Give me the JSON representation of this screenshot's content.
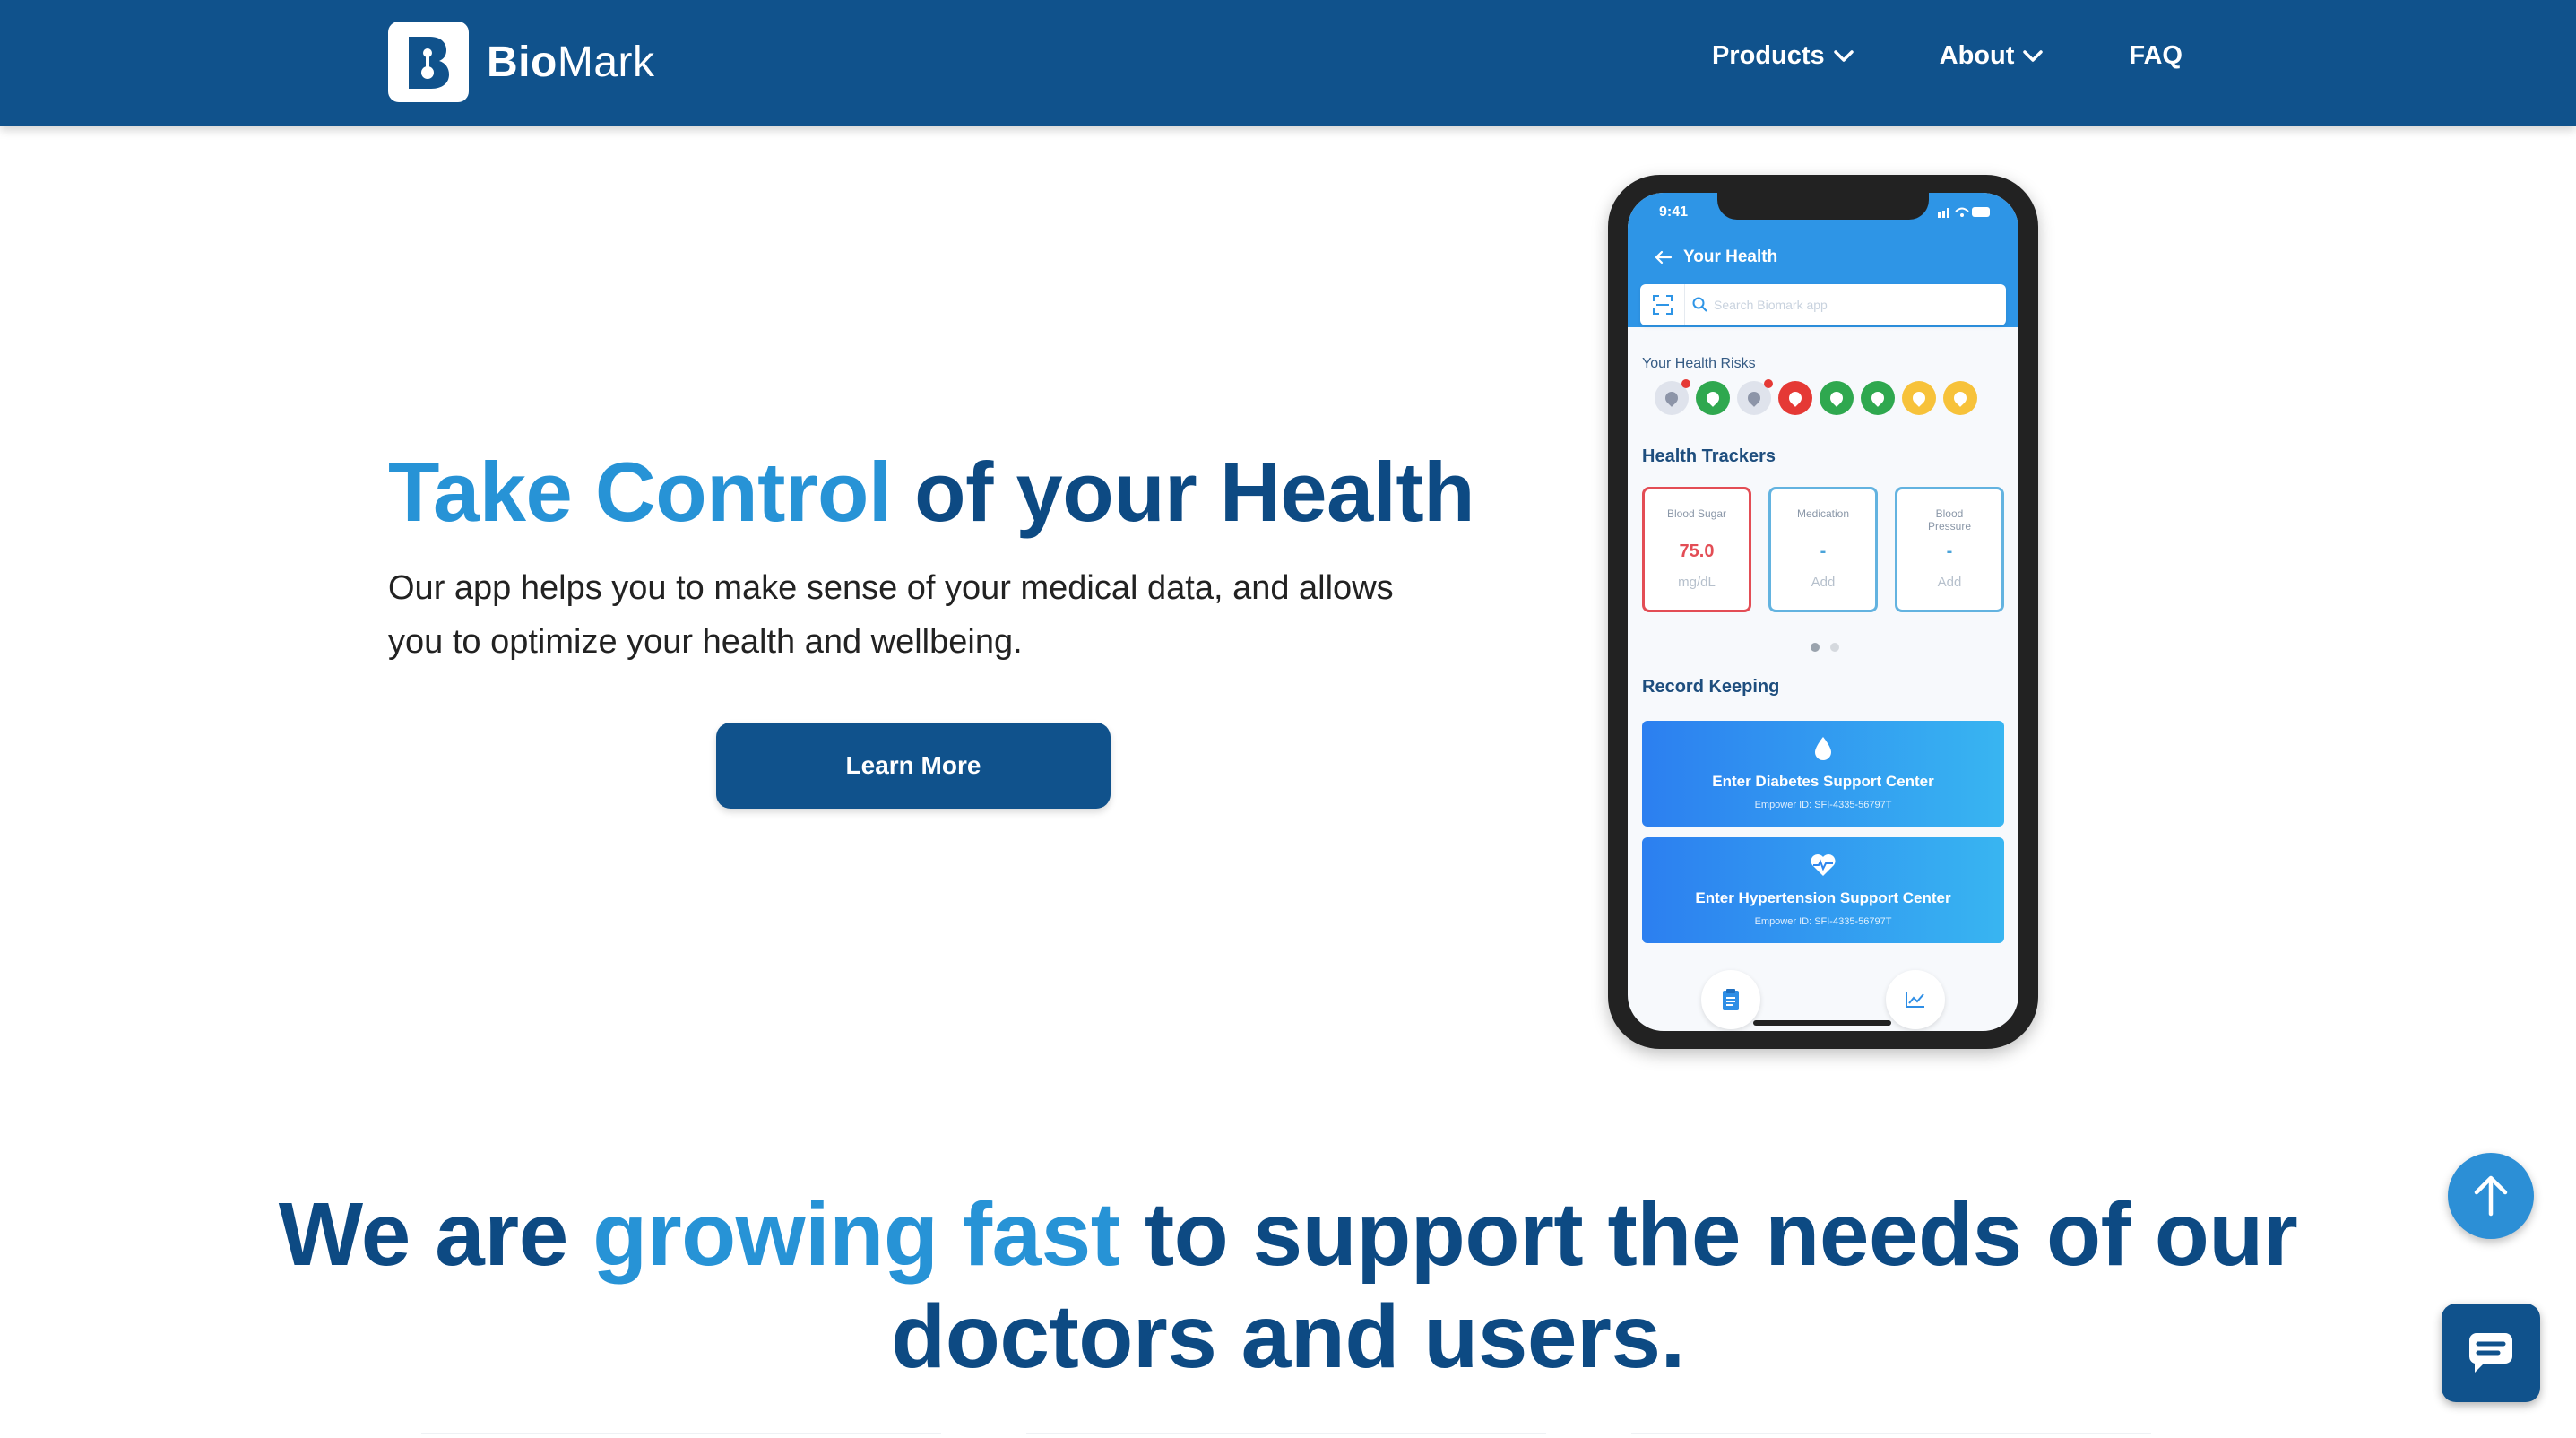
{
  "header": {
    "brand_bold": "Bio",
    "brand_light": "Mark",
    "nav": [
      {
        "label": "Products",
        "has_dropdown": true
      },
      {
        "label": "About",
        "has_dropdown": true
      },
      {
        "label": "FAQ",
        "has_dropdown": false
      }
    ]
  },
  "hero": {
    "title_accent": "Take Control",
    "title_rest": " of your Health",
    "subtitle": "Our app helps you to make sense of your medical data, and allows you to optimize your health and wellbeing.",
    "cta_label": "Learn More"
  },
  "phone": {
    "time": "9:41",
    "screen_title": "Your Health",
    "search_placeholder": "Search Biomark app",
    "risks_label": "Your Health Risks",
    "risks": [
      {
        "icon": "heart-icon",
        "color": "#dfe3ec",
        "alert": true
      },
      {
        "icon": "drop-icon",
        "color": "#2fa84f",
        "alert": false
      },
      {
        "icon": "heartbeat-icon",
        "color": "#dfe3ec",
        "alert": true
      },
      {
        "icon": "blood-icon",
        "color": "#e53935",
        "alert": false
      },
      {
        "icon": "vessel-icon",
        "color": "#2fa84f",
        "alert": false
      },
      {
        "icon": "kidney-icon",
        "color": "#2fa84f",
        "alert": false
      },
      {
        "icon": "lightning-icon",
        "color": "#f7c23a",
        "alert": false
      },
      {
        "icon": "moon-icon",
        "color": "#f7c23a",
        "alert": false
      }
    ],
    "trackers_heading": "Health Trackers",
    "trackers": [
      {
        "name": "Blood Sugar",
        "value": "75.0",
        "unit": "mg/dL",
        "alert": true
      },
      {
        "name": "Medication",
        "value": "-",
        "unit": "Add",
        "alert": false
      },
      {
        "name": "Blood Pressure",
        "value": "-",
        "unit": "Add",
        "alert": false
      }
    ],
    "record_heading": "Record Keeping",
    "records": [
      {
        "title": "Enter Diabetes Support Center",
        "sub": "Empower ID: SFI-4335-56797T",
        "icon": "drop-icon"
      },
      {
        "title": "Enter Hypertension Support Center",
        "sub": "Empower ID: SFI-4335-56797T",
        "icon": "heartbeat-icon"
      }
    ]
  },
  "section2": {
    "pre": "We are ",
    "accent": "growing fast",
    "post": " to support the needs of our doctors and users."
  },
  "colors": {
    "brand_dark": "#10528c",
    "accent": "#2793d6",
    "heading": "#0d4a83"
  }
}
